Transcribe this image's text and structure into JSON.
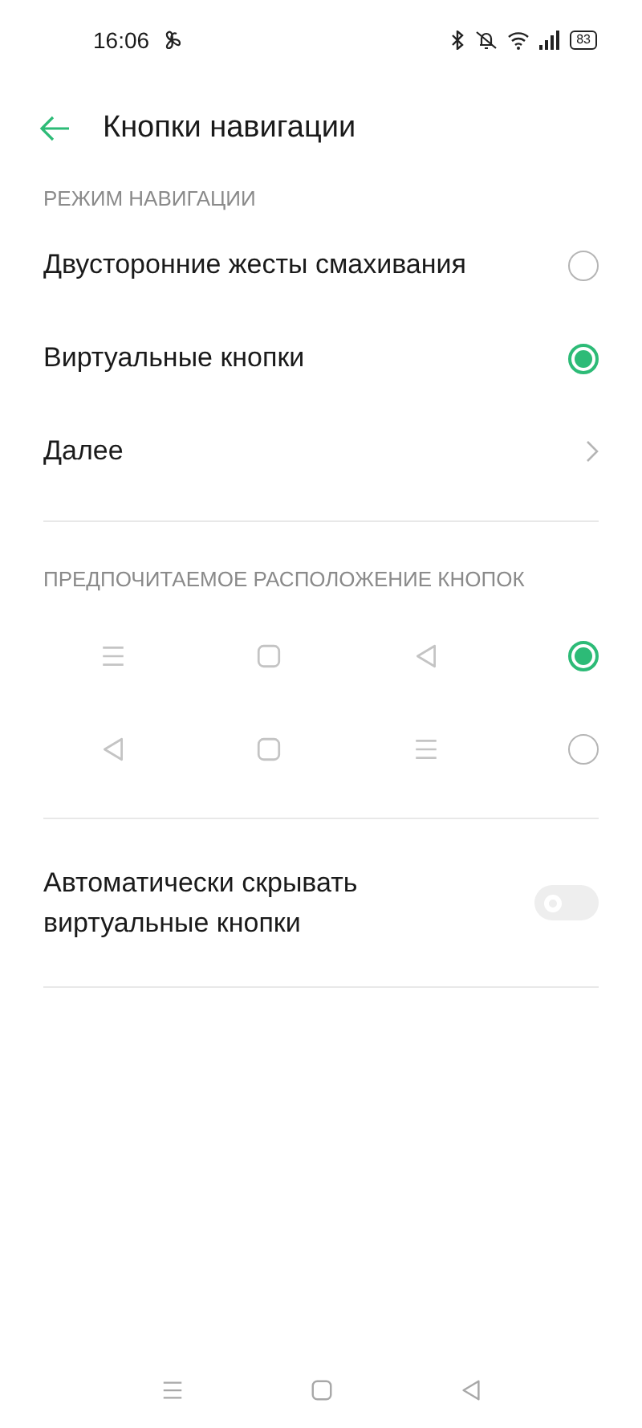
{
  "status_bar": {
    "time": "16:06",
    "battery": "83"
  },
  "header": {
    "title": "Кнопки навигации"
  },
  "navigation_mode": {
    "heading": "РЕЖИМ НАВИГАЦИИ",
    "options": [
      {
        "label": "Двусторонние жесты смахивания",
        "selected": false
      },
      {
        "label": "Виртуальные кнопки",
        "selected": true
      }
    ],
    "more": {
      "label": "Далее"
    }
  },
  "button_layout": {
    "heading": "ПРЕДПОЧИТАЕМОЕ РАСПОЛОЖЕНИЕ КНОПОК",
    "options": [
      {
        "selected": true,
        "buttons": [
          {
            "kind": "menu"
          },
          {
            "kind": "home"
          },
          {
            "kind": "back"
          }
        ]
      },
      {
        "selected": false,
        "buttons": [
          {
            "kind": "back"
          },
          {
            "kind": "home"
          },
          {
            "kind": "menu"
          }
        ]
      }
    ]
  },
  "auto_hide": {
    "label": "Автоматически скрывать виртуальные кнопки",
    "on": false
  },
  "nav_bar": {
    "buttons": [
      {
        "kind": "menu"
      },
      {
        "kind": "home"
      },
      {
        "kind": "back"
      }
    ]
  }
}
